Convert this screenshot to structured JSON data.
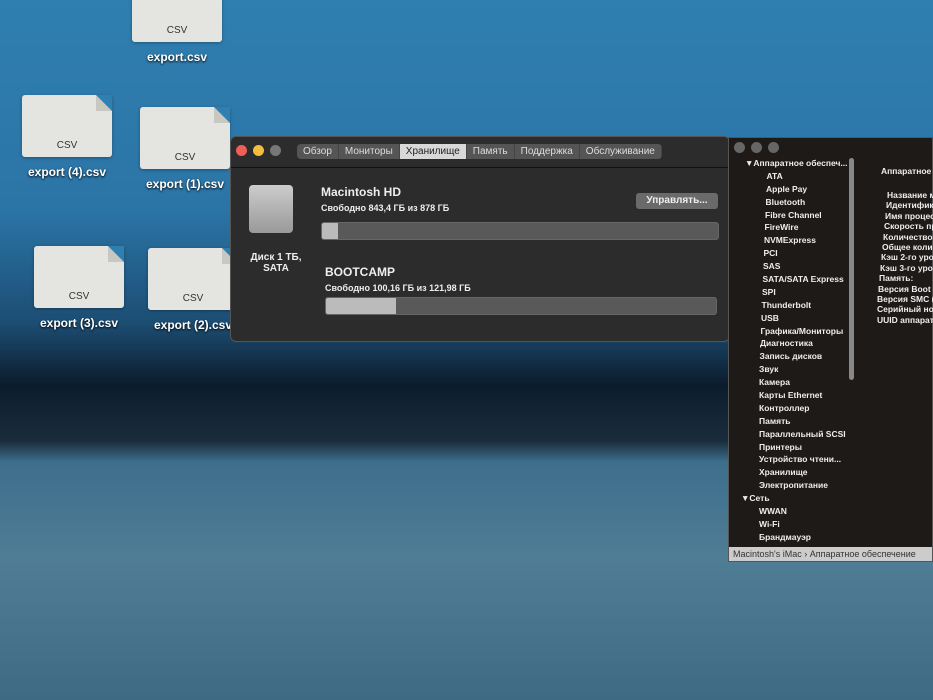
{
  "desktop": {
    "files": [
      {
        "name": "export.csv",
        "type": "CSV"
      },
      {
        "name": "export (4).csv",
        "type": "CSV"
      },
      {
        "name": "export (1).csv",
        "type": "CSV"
      },
      {
        "name": "export (3).csv",
        "type": "CSV"
      },
      {
        "name": "export (2).csv",
        "type": "CSV"
      }
    ]
  },
  "about": {
    "tabs": [
      "Обзор",
      "Мониторы",
      "Хранилище",
      "Память",
      "Поддержка",
      "Обслуживание"
    ],
    "disk_label": "Диск 1 ТБ, SATA",
    "manage": "Управлять...",
    "volumes": [
      {
        "name": "Macintosh HD",
        "free": "Свободно 843,4 ГБ из 878 ГБ",
        "used_fraction": 0.04
      },
      {
        "name": "BOOTCAMP",
        "free": "Свободно 100,16 ГБ из 121,98 ГБ",
        "used_fraction": 0.18
      }
    ]
  },
  "sysinfo": {
    "sidebar": [
      "▼Аппаратное обеспеч...",
      "ATA",
      "Apple Pay",
      "Bluetooth",
      "Fibre Channel",
      "FireWire",
      "NVMExpress",
      "PCI",
      "SAS",
      "SATA/SATA Express",
      "SPI",
      "Thunderbolt",
      "USB",
      "Графика/Мониторы",
      "Диагностика",
      "Запись дисков",
      "Звук",
      "Камера",
      "Карты Ethernet",
      "Контроллер",
      "Память",
      "Параллельный SCSI",
      "Принтеры",
      "Устройство чтени...",
      "Хранилище",
      "Электропитание",
      "▼Сеть",
      "WWAN",
      "Wi-Fi",
      "Брандмауэр"
    ],
    "header": "Аппаратное",
    "details": [
      "Название м",
      "Идентифика",
      "Имя процес",
      "Скорость пр",
      "Количество",
      "Общее колич",
      "Кэш 2-го уро",
      "Кэш 3-го уро",
      "Память:",
      "Версия Boot R",
      "Версия SMC (",
      "Серийный ном",
      "UUID аппарат"
    ],
    "path": "Macintosh's iMac › Аппаратное обеспечение"
  }
}
